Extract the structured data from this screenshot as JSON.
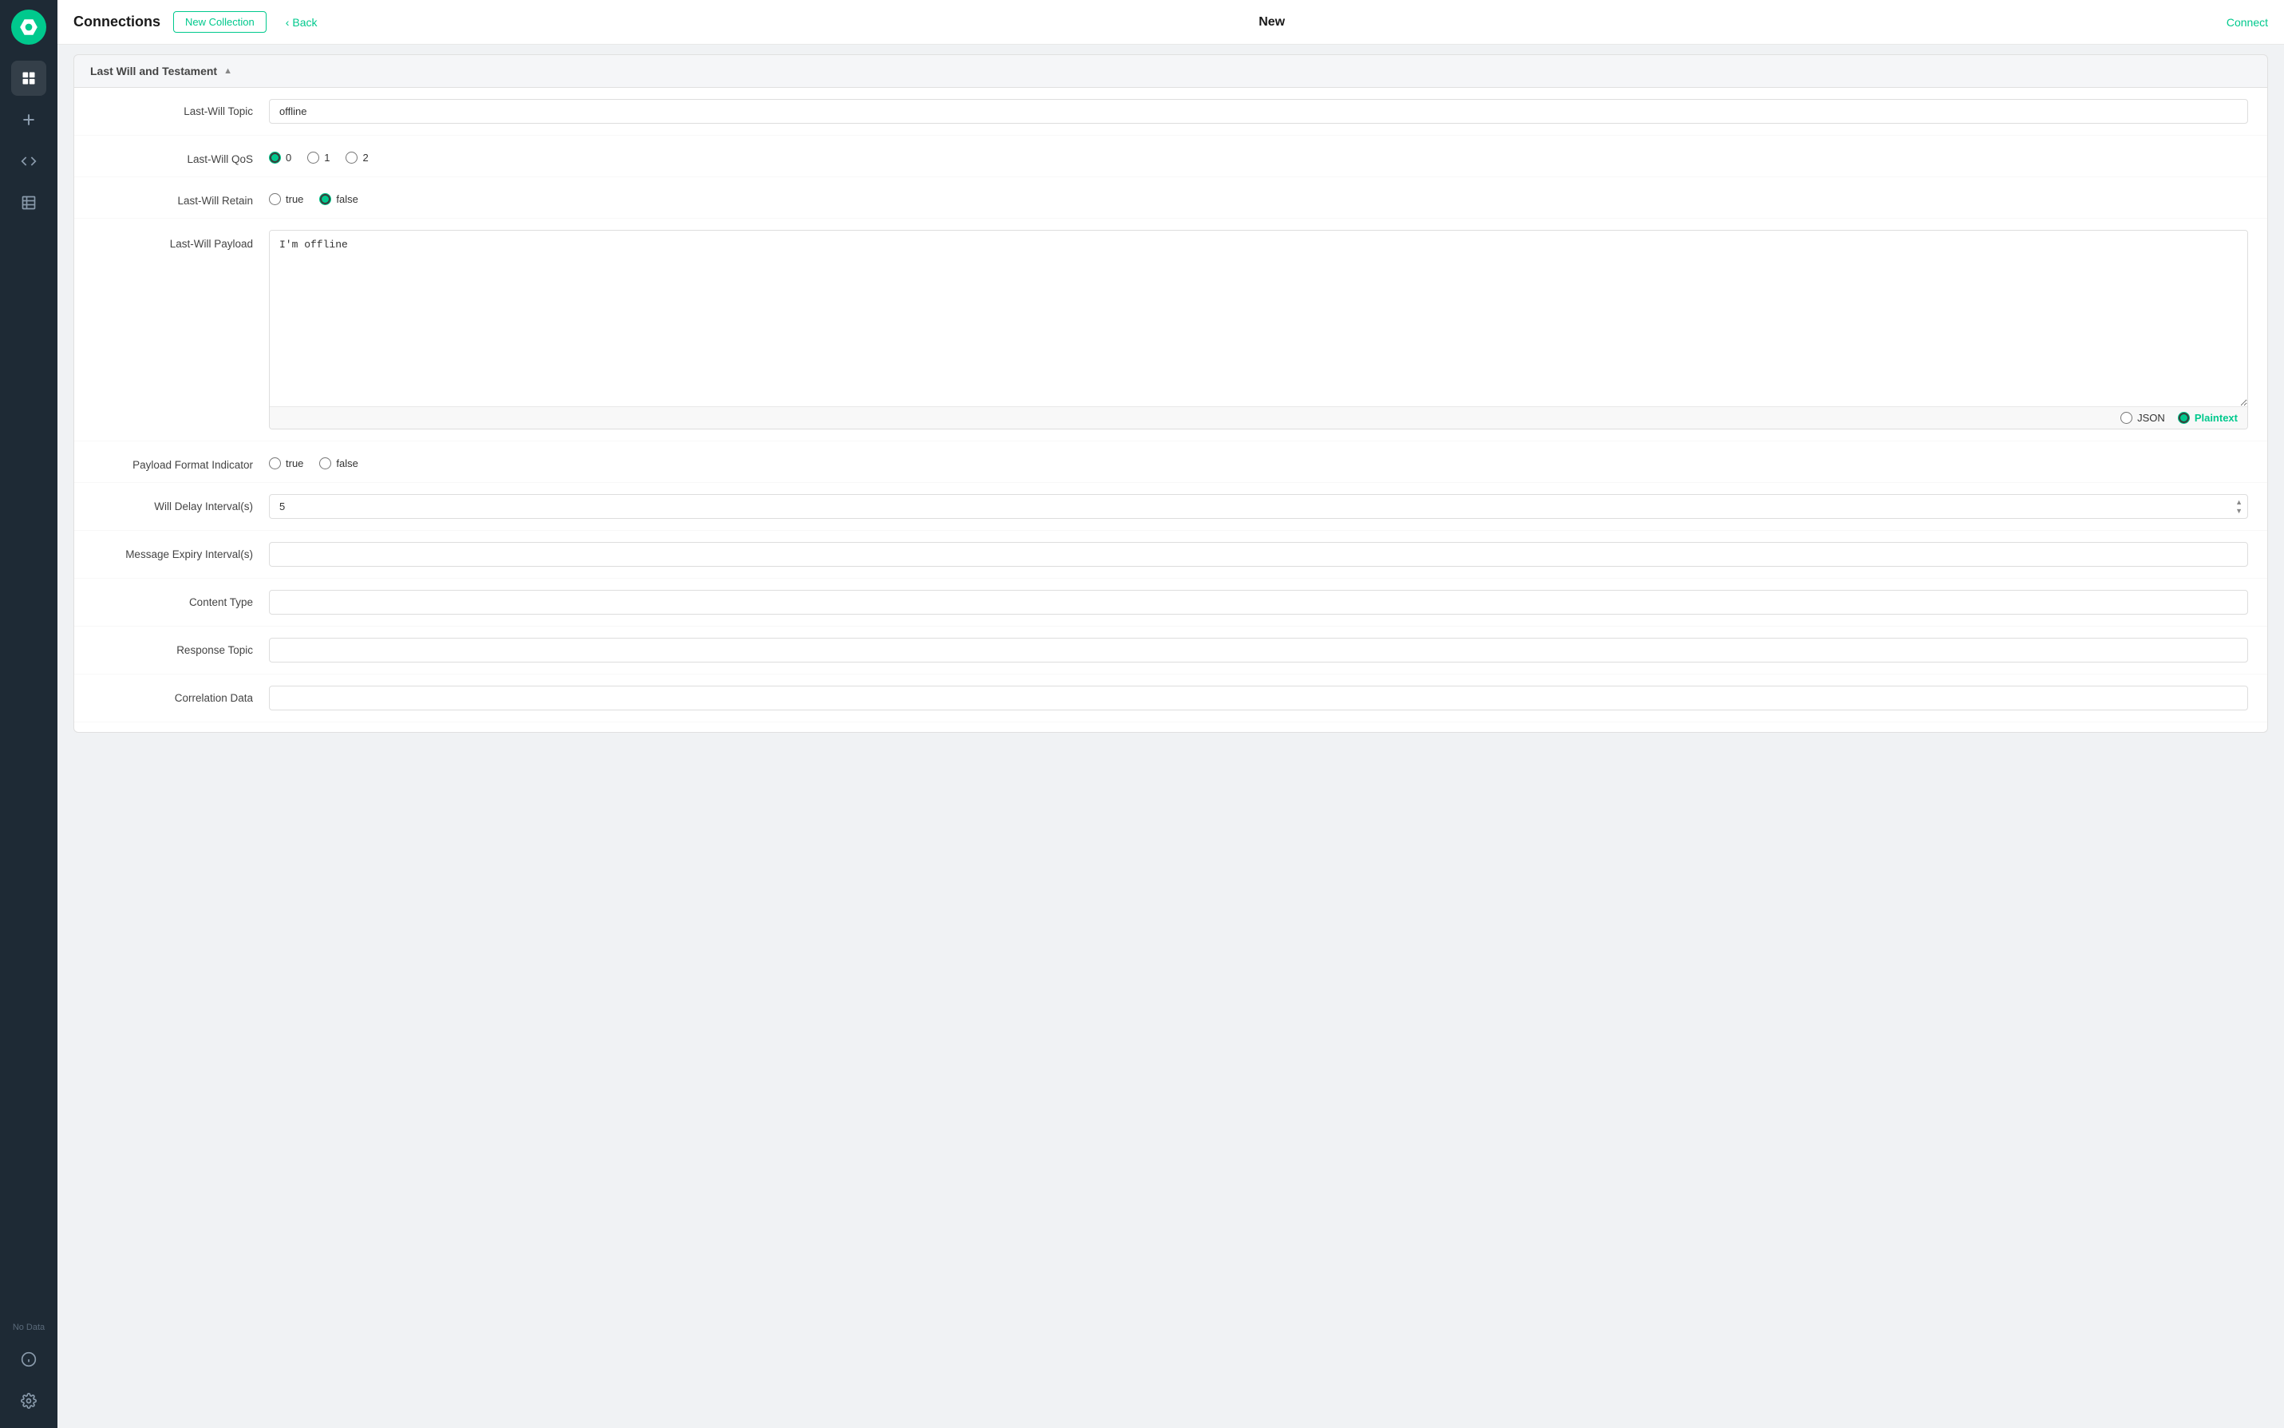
{
  "sidebar": {
    "logo_alt": "App Logo",
    "items": [
      {
        "name": "connections",
        "icon": "⊞",
        "active": true
      },
      {
        "name": "add",
        "icon": "+"
      },
      {
        "name": "code",
        "icon": "</>"
      },
      {
        "name": "data-table",
        "icon": "▦"
      }
    ],
    "bottom_items": [
      {
        "name": "info",
        "icon": "ℹ"
      },
      {
        "name": "settings",
        "icon": "⚙"
      }
    ],
    "no_data_label": "No Data"
  },
  "header": {
    "title": "Connections",
    "new_collection_label": "New Collection",
    "back_label": "Back",
    "page_title": "New",
    "connect_label": "Connect"
  },
  "section": {
    "title": "Last Will and Testament",
    "chevron": "▲"
  },
  "form": {
    "last_will_topic_label": "Last-Will Topic",
    "last_will_topic_value": "offline",
    "last_will_topic_placeholder": "",
    "last_will_qos_label": "Last-Will QoS",
    "last_will_qos_options": [
      "0",
      "1",
      "2"
    ],
    "last_will_qos_selected": "0",
    "last_will_retain_label": "Last-Will Retain",
    "last_will_retain_options": [
      "true",
      "false"
    ],
    "last_will_retain_selected": "false",
    "last_will_payload_label": "Last-Will Payload",
    "last_will_payload_value": "I'm offline",
    "payload_format_json": "JSON",
    "payload_format_plaintext": "Plaintext",
    "payload_format_selected": "Plaintext",
    "payload_format_indicator_label": "Payload Format Indicator",
    "payload_format_indicator_options": [
      "true",
      "false"
    ],
    "payload_format_indicator_selected": "",
    "will_delay_label": "Will Delay Interval(s)",
    "will_delay_value": "5",
    "message_expiry_label": "Message Expiry Interval(s)",
    "message_expiry_value": "",
    "content_type_label": "Content Type",
    "content_type_value": "",
    "response_topic_label": "Response Topic",
    "response_topic_value": "",
    "correlation_data_label": "Correlation Data",
    "correlation_data_value": ""
  },
  "colors": {
    "accent": "#00c98d",
    "sidebar_bg": "#1e2a35",
    "border": "#e0e0e0"
  }
}
